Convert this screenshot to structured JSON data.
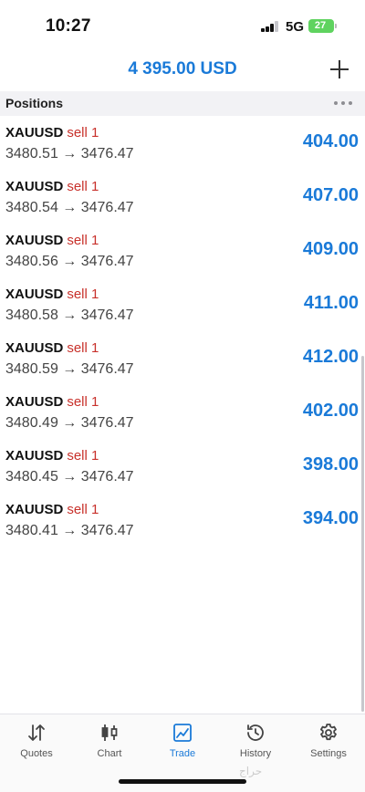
{
  "status_bar": {
    "time": "10:27",
    "network": "5G",
    "battery": "27"
  },
  "header": {
    "balance": "4 395.00 USD"
  },
  "section": {
    "title": "Positions"
  },
  "positions": [
    {
      "symbol": "XAUUSD",
      "side": "sell 1",
      "prices": "3480.51 → 3476.47",
      "profit": "404.00"
    },
    {
      "symbol": "XAUUSD",
      "side": "sell 1",
      "prices": "3480.54 → 3476.47",
      "profit": "407.00"
    },
    {
      "symbol": "XAUUSD",
      "side": "sell 1",
      "prices": "3480.56 → 3476.47",
      "profit": "409.00"
    },
    {
      "symbol": "XAUUSD",
      "side": "sell 1",
      "prices": "3480.58 → 3476.47",
      "profit": "411.00"
    },
    {
      "symbol": "XAUUSD",
      "side": "sell 1",
      "prices": "3480.59 → 3476.47",
      "profit": "412.00"
    },
    {
      "symbol": "XAUUSD",
      "side": "sell 1",
      "prices": "3480.49 → 3476.47",
      "profit": "402.00"
    },
    {
      "symbol": "XAUUSD",
      "side": "sell 1",
      "prices": "3480.45 → 3476.47",
      "profit": "398.00"
    },
    {
      "symbol": "XAUUSD",
      "side": "sell 1",
      "prices": "3480.41 → 3476.47",
      "profit": "394.00"
    }
  ],
  "tabs": [
    {
      "label": "Quotes",
      "icon": "quotes-icon"
    },
    {
      "label": "Chart",
      "icon": "chart-icon"
    },
    {
      "label": "Trade",
      "icon": "trade-icon",
      "active": true
    },
    {
      "label": "History",
      "icon": "history-icon"
    },
    {
      "label": "Settings",
      "icon": "settings-icon"
    }
  ],
  "watermark": "حراج",
  "colors": {
    "accent": "#1a7ad8",
    "sell": "#c8312b"
  }
}
